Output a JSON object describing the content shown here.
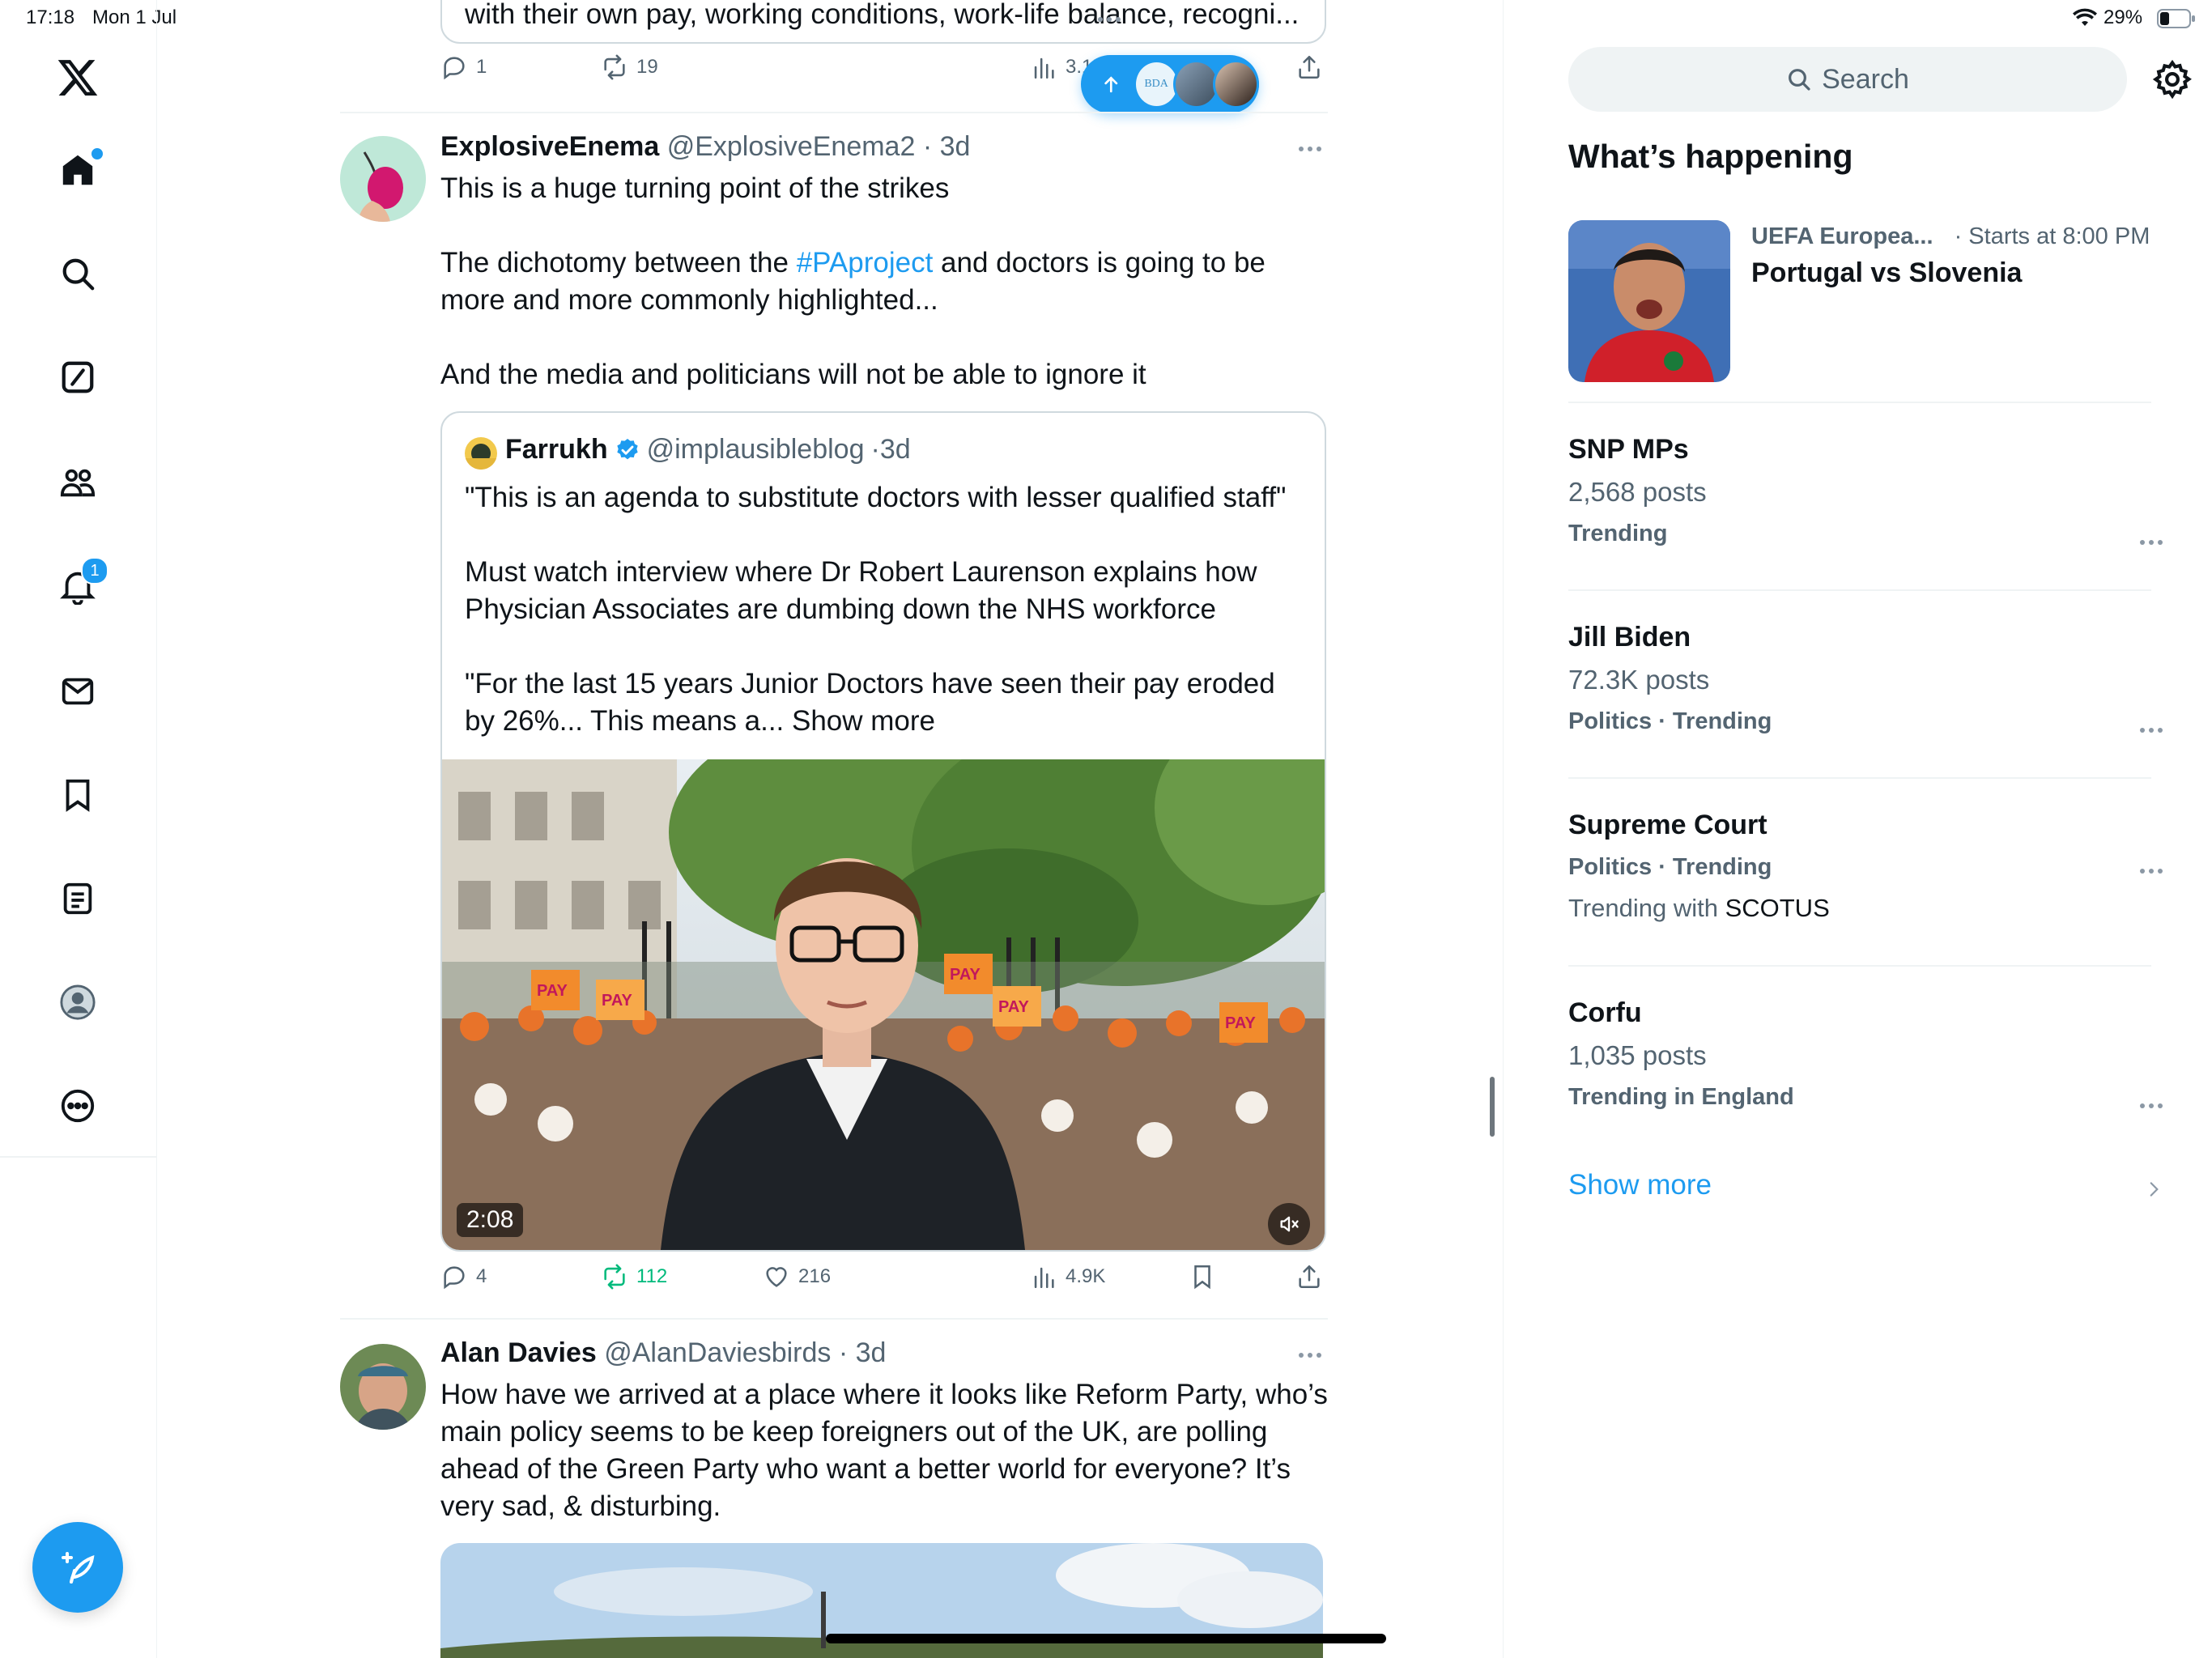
{
  "status_bar": {
    "time": "17:18",
    "date": "Mon 1 Jul",
    "battery": "29%"
  },
  "nav": {
    "items": [
      "home-icon",
      "search-icon",
      "grok-icon",
      "communities-icon",
      "notifications-icon",
      "messages-icon",
      "bookmarks-icon",
      "lists-icon",
      "profile-icon",
      "more-icon"
    ],
    "notifications_badge": "1",
    "accent": "#1d9bf0"
  },
  "feed": {
    "prev_tweet": {
      "cut_text": "with their own pay, working conditions, work-life balance, recogni...",
      "replies": "1",
      "reposts": "19",
      "views": "3.1K"
    },
    "new_posts_pill": {
      "avatar_label": "BDA"
    },
    "tweet1": {
      "name": "ExplosiveEnema",
      "handle": "@ExplosiveEnema2",
      "time": "3d",
      "line1": "This is a huge turning point of the strikes",
      "para2_a": "The dichotomy between the ",
      "hashtag": "#PAproject",
      "para2_b": " and doctors is going to be more and more commonly highlighted...",
      "para3": "And the media and politicians will not be able to ignore it",
      "quote": {
        "name": "Farrukh",
        "handle": "@implausibleblog",
        "time": "3d",
        "p1": "\"This is an agenda to substitute doctors with lesser qualified staff\"",
        "p2": "Must watch interview where Dr Robert Laurenson explains how Physician Associates are dumbing down the NHS workforce",
        "p3": "\"For the last 15 years Junior Doctors have seen their pay eroded by 26%... This means a...",
        "show_more": "Show more",
        "video_time": "2:08",
        "signs": [
          "PAY",
          "PAY",
          "PAY",
          "PAY",
          "PAY"
        ]
      },
      "replies": "4",
      "reposts": "112",
      "likes": "216",
      "views": "4.9K"
    },
    "tweet2": {
      "name": "Alan Davies",
      "handle": "@AlanDaviesbirds",
      "time": "3d",
      "text": "How have we arrived at a place where it looks like Reform Party, who’s main policy seems to be keep foreigners out of the UK, are polling ahead of the Green Party who want a better world for everyone? It’s very sad, & disturbing."
    }
  },
  "sidebar": {
    "search_placeholder": "Search",
    "section_title": "What’s happening",
    "event": {
      "category": "UEFA Europea...",
      "time": "· Starts at 8:00 PM",
      "title": "Portugal vs Slovenia"
    },
    "trends": [
      {
        "title": "SNP MPs",
        "sub": "2,568 posts",
        "cat": "Trending"
      },
      {
        "title": "Jill Biden",
        "sub": "72.3K posts",
        "cat": "Politics · Trending"
      },
      {
        "title": "Supreme Court",
        "cat": "Politics · Trending",
        "with_prefix": "Trending with ",
        "with": "SCOTUS"
      },
      {
        "title": "Corfu",
        "sub": "1,035 posts",
        "cat": "Trending in England"
      }
    ],
    "show_more": "Show more"
  }
}
